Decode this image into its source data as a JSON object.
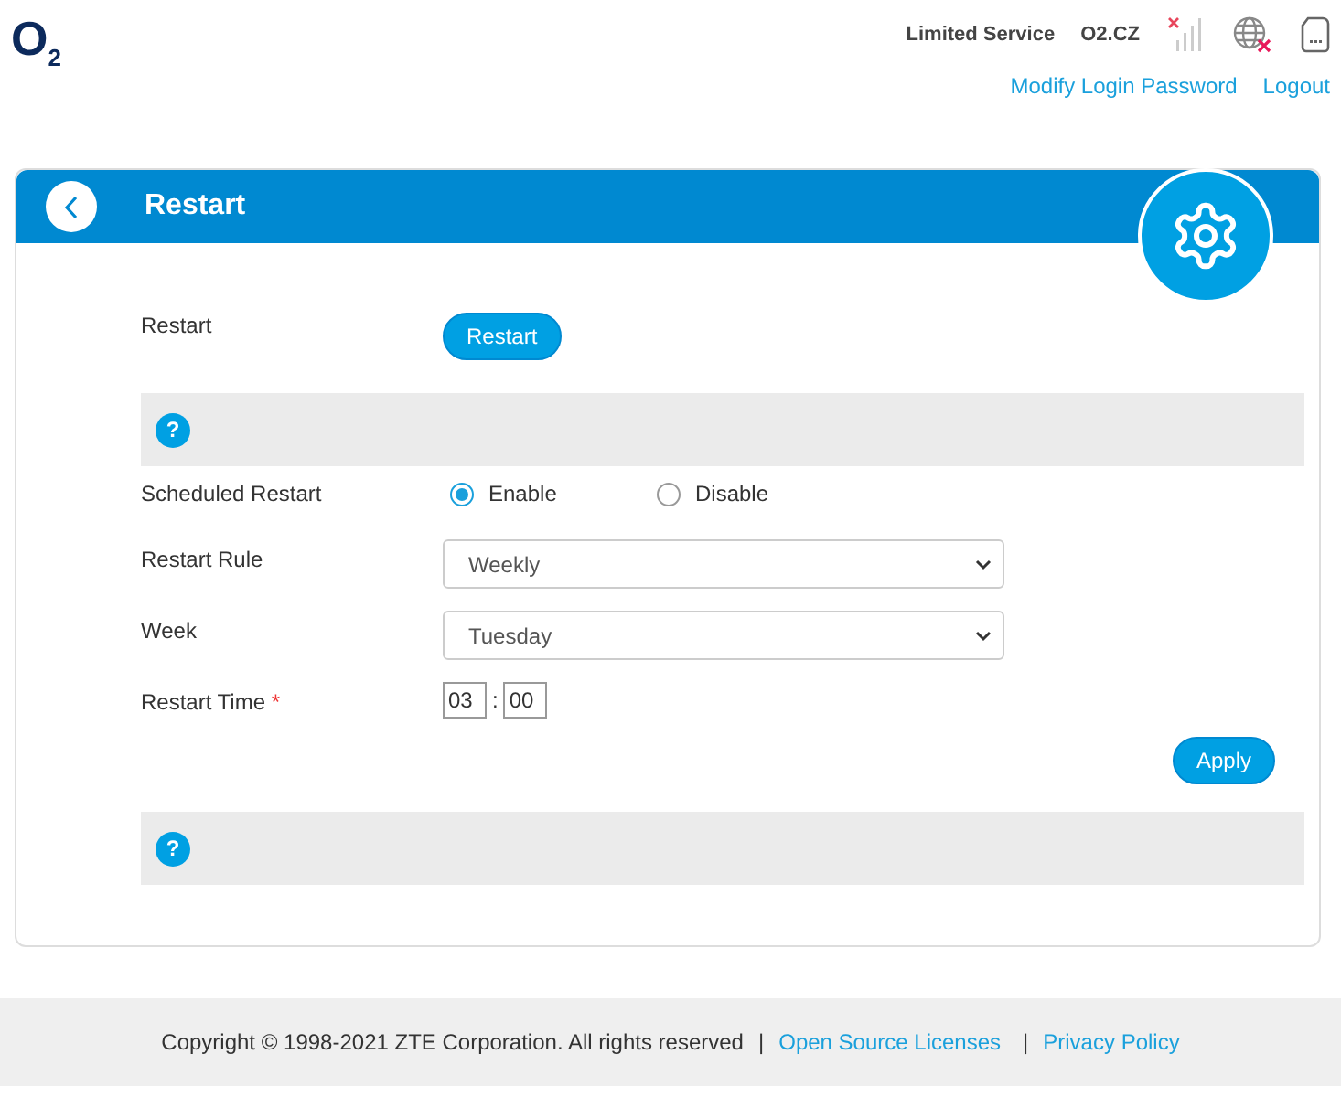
{
  "header": {
    "logo": "O$_{2}$",
    "service": "Limited Service",
    "operator": "O2.CZ",
    "links": [
      "Modify Login Password",
      "Logout"
    ]
  },
  "panel": {
    "title": "Restart",
    "restart_row": {
      "label": "Restart",
      "button": "Restart"
    },
    "scheduled": {
      "label": "Scheduled Restart",
      "options": [
        {
          "label": "Enable",
          "selected": true
        },
        {
          "label": "Disable",
          "selected": false
        }
      ]
    },
    "rule": {
      "label": "Restart Rule",
      "value": "Weekly"
    },
    "week": {
      "label": "Week",
      "value": "Tuesday"
    },
    "time": {
      "label": "Restart Time",
      "required": "*",
      "hour": "03",
      "separator": ":",
      "minute": "00"
    },
    "apply": "Apply",
    "help_icons": [
      "?",
      "?"
    ]
  },
  "footer": {
    "copyright": "Copyright © 1998-2021 ZTE Corporation. All rights reserved",
    "separators": [
      "|",
      "|"
    ],
    "links": [
      "Open Source Licenses",
      "Privacy Policy"
    ]
  }
}
